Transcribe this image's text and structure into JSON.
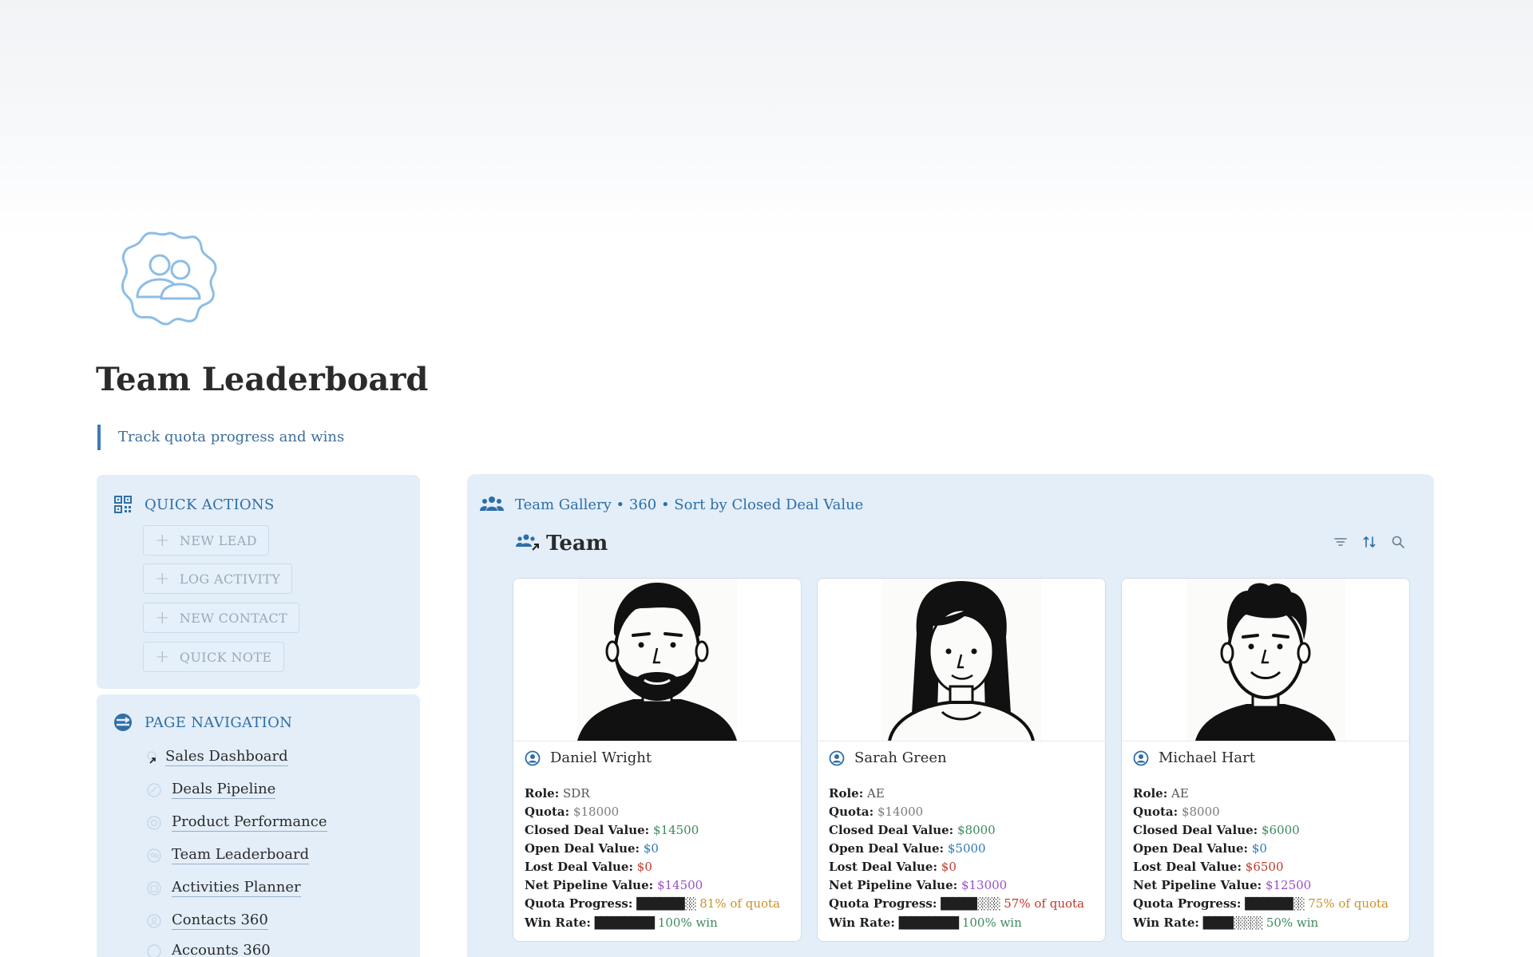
{
  "page": {
    "title": "Team Leaderboard",
    "quote": "Track quota progress and wins",
    "icon": "team-badge-icon"
  },
  "quick_actions": {
    "title": "QUICK ACTIONS",
    "buttons": [
      {
        "label": "NEW LEAD"
      },
      {
        "label": "LOG ACTIVITY"
      },
      {
        "label": "NEW CONTACT"
      },
      {
        "label": "QUICK NOTE"
      }
    ]
  },
  "navigation": {
    "title": "PAGE NAVIGATION",
    "items": [
      {
        "label": "Sales Dashboard"
      },
      {
        "label": "Deals Pipeline"
      },
      {
        "label": "Product Performance"
      },
      {
        "label": "Team Leaderboard"
      },
      {
        "label": "Activities Planner"
      },
      {
        "label": "Contacts 360"
      },
      {
        "label": "Accounts 360"
      }
    ]
  },
  "gallery": {
    "header": "Team Gallery • 360 • Sort by Closed Deal Value",
    "view_title": "Team",
    "tools": [
      "filter-icon",
      "sort-icon",
      "search-icon"
    ],
    "field_labels": {
      "role": "Role:",
      "quota": "Quota:",
      "closed": "Closed Deal Value:",
      "open": "Open Deal Value:",
      "lost": "Lost Deal Value:",
      "net": "Net Pipeline Value:",
      "progress": "Quota Progress:",
      "win": "Win Rate:"
    },
    "cards": [
      {
        "name": "Daniel Wright",
        "role": "SDR",
        "quota": "$18000",
        "closed": "$14500",
        "open": "$0",
        "lost": "$0",
        "net": "$14500",
        "progress_bar": "████████░░",
        "progress_text": "81% of quota",
        "win_bar": "██████████",
        "win_text": "100% win"
      },
      {
        "name": "Sarah Green",
        "role": "AE",
        "quota": "$14000",
        "closed": "$8000",
        "open": "$5000",
        "lost": "$0",
        "net": "$13000",
        "progress_bar": "██████░░░░",
        "progress_text": "57% of quota",
        "win_bar": "██████████",
        "win_text": "100% win"
      },
      {
        "name": "Michael Hart",
        "role": "AE",
        "quota": "$8000",
        "closed": "$6000",
        "open": "$0",
        "lost": "$6500",
        "net": "$12500",
        "progress_bar": "████████░░",
        "progress_text": "75% of quota",
        "win_bar": "█████░░░░░",
        "win_text": "50% win"
      }
    ]
  },
  "colors": {
    "accent": "#2f6ea6",
    "panel_bg": "#e3eef9",
    "green": "#3d8a5f",
    "blue": "#2e78b7",
    "red": "#c0392b",
    "purple": "#9b4fc4",
    "orange": "#c8922a"
  }
}
